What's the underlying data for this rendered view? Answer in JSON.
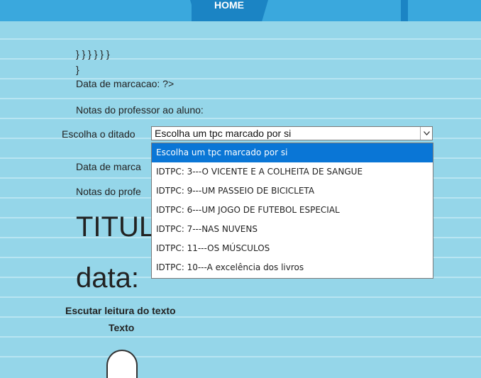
{
  "nav": {
    "home": "HOME"
  },
  "content": {
    "braces1": "} } } } } }",
    "braces2": "}",
    "data_marcacao": "Data de marcacao: ?>",
    "notas_professor": "Notas do professor ao aluno:",
    "escolha_label": "Escolha o ditado",
    "data_marca_partial": "Data de marca",
    "notas_profe_partial": "Notas do profe",
    "titulo_partial": "TITUL",
    "data_big": "data:",
    "escutar": "Escutar leitura do texto",
    "texto": "Texto"
  },
  "select": {
    "value": "Escolha um tpc marcado por si",
    "options": [
      "Escolha um tpc marcado por si",
      "IDTPC: 3---O VICENTE E A COLHEITA DE SANGUE",
      "IDTPC: 9---UM PASSEIO DE BICICLETA",
      "IDTPC: 6---UM JOGO DE FUTEBOL ESPECIAL",
      "IDTPC: 7---NAS NUVENS",
      "IDTPC: 11---OS MÚSCULOS",
      "IDTPC: 10---A excelência dos livros"
    ],
    "selected_index": 0
  },
  "icons": {
    "select_arrow": "chevron-down-icon",
    "audio": "headphones-icon"
  },
  "colors": {
    "background": "#95d6e9",
    "nav": "#1b84c4",
    "selected_option": "#0a76d6"
  }
}
